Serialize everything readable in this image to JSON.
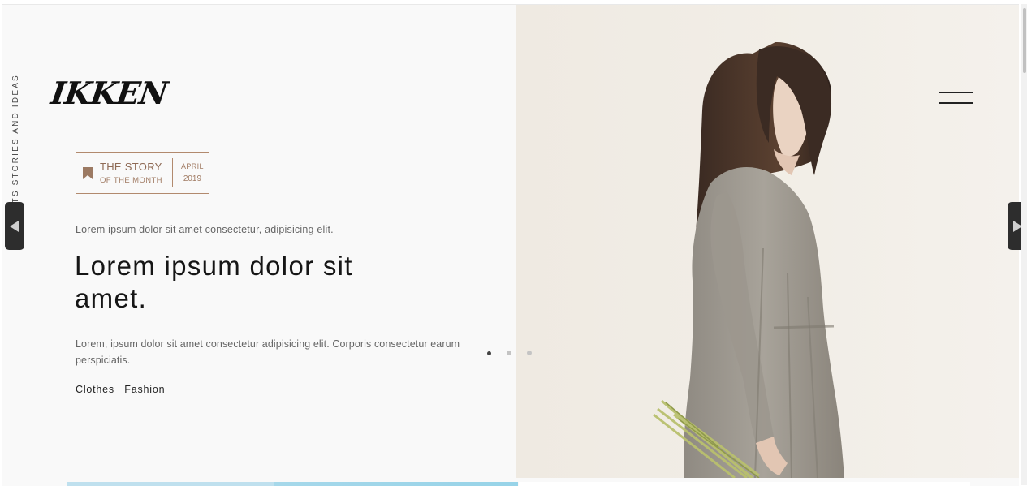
{
  "brand": {
    "logo": "IKKEN"
  },
  "sidebar": {
    "vertical_tagline": "THOUGHTS STORIES AND IDEAS"
  },
  "story_badge": {
    "title": "THE STORY",
    "subtitle": "OF THE MONTH",
    "month": "APRIL",
    "year": "2019",
    "icon": "bookmark-icon",
    "color": "#b28a6e"
  },
  "hero": {
    "intro": "Lorem ipsum dolor sit amet consectetur, adipisicing elit.",
    "headline": "Lorem ipsum dolor sit amet.",
    "body": "Lorem, ipsum dolor sit amet consectetur adipisicing elit. Corporis consectetur earum perspiciatis.",
    "tags": [
      "Clothes",
      "Fashion"
    ]
  },
  "slider": {
    "dots_count": 3,
    "active_dot": 1,
    "prev_icon": "triangle-left-icon",
    "next_icon": "triangle-right-icon"
  },
  "header": {
    "menu_icon": "hamburger-menu-icon"
  },
  "colors": {
    "accent": "#b28a6e",
    "left_background": "#f9f9f9",
    "right_background": "#f1ede6",
    "text_dark": "#161616"
  }
}
